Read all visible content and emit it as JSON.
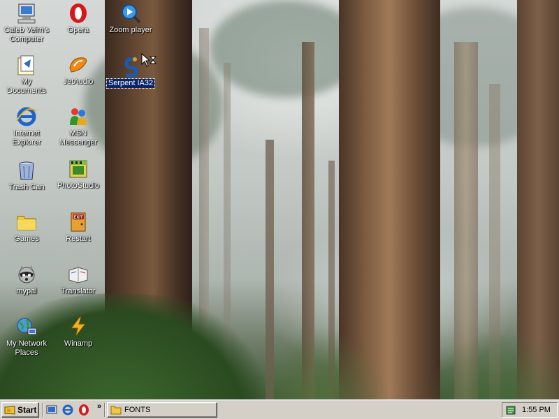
{
  "desktop": {
    "icons": [
      {
        "label": "Caleb Veirn's Computer",
        "icon": "my-computer-icon"
      },
      {
        "label": "Opera",
        "icon": "opera-icon"
      },
      {
        "label": "Zoom player",
        "icon": "zoom-player-icon"
      },
      {
        "label": "My Documents",
        "icon": "my-documents-icon"
      },
      {
        "label": "JetAudio",
        "icon": "jetaudio-icon"
      },
      {
        "label": "Serpent IA32",
        "icon": "serpent-icon",
        "selected": true
      },
      {
        "label": "Internet Explorer",
        "icon": "internet-explorer-icon"
      },
      {
        "label": "MSN Messenger",
        "icon": "msn-messenger-icon"
      },
      {
        "label": "Trash Can",
        "icon": "trash-can-icon"
      },
      {
        "label": "PhotoStudio",
        "icon": "photostudio-icon"
      },
      {
        "label": "Games",
        "icon": "folder-icon"
      },
      {
        "label": "Restart",
        "icon": "exit-icon"
      },
      {
        "label": "mypal",
        "icon": "raccoon-icon"
      },
      {
        "label": "Translator",
        "icon": "translator-icon"
      },
      {
        "label": "My Network Places",
        "icon": "network-places-icon"
      },
      {
        "label": "Winamp",
        "icon": "winamp-icon"
      }
    ]
  },
  "taskbar": {
    "start_label": "Start",
    "quick_launch": [
      "show-desktop-icon",
      "internet-explorer-icon",
      "opera-icon"
    ],
    "chevron": "»",
    "tasks": [
      {
        "label": "FONTS",
        "icon": "folder-icon"
      }
    ],
    "tray": {
      "clock": "1:55 PM",
      "icon": "tray-app-icon"
    }
  },
  "colors": {
    "taskbar": "#d4d0c8",
    "selection": "#0a246a",
    "desktop_text": "#ffffff"
  }
}
